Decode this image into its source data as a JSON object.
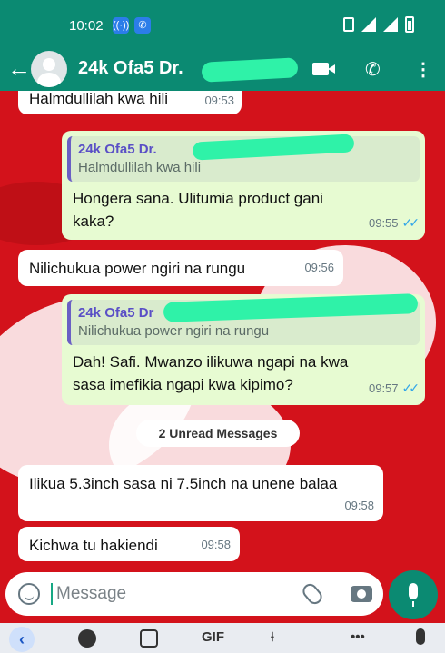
{
  "status_bar": {
    "time": "10:02"
  },
  "header": {
    "title": "24k Ofa5 Dr."
  },
  "messages": [
    {
      "dir": "in",
      "text": "Halmdullilah kwa hili",
      "time": "09:53"
    },
    {
      "dir": "out",
      "quote": {
        "name": "24k Ofa5 Dr.",
        "text": "Halmdullilah kwa hili"
      },
      "text": "Hongera sana. Ulitumia product gani kaka?",
      "time": "09:55",
      "status": "read"
    },
    {
      "dir": "in",
      "text": "Nilichukua power ngiri na rungu",
      "time": "09:56"
    },
    {
      "dir": "out",
      "quote": {
        "name": "24k Ofa5 Dr",
        "text": "Nilichukua power ngiri na rungu"
      },
      "text": "Dah! Safi. Mwanzo ilikuwa ngapi na kwa sasa imefikia ngapi kwa kipimo?",
      "time": "09:57",
      "status": "read"
    },
    {
      "dir": "in",
      "text": "Ilikua 5.3inch sasa ni 7.5inch na unene balaa",
      "time": "09:58"
    },
    {
      "dir": "in",
      "text": "Kichwa tu hakiendi",
      "time": "09:58"
    }
  ],
  "unread_label": "2 Unread Messages",
  "input": {
    "placeholder": "Message"
  },
  "keyboard": {
    "gif_label": "GIF",
    "more_label": "•••"
  },
  "colors": {
    "header": "#0b8a72",
    "outgoing": "#e7fbd2",
    "incoming": "#ffffff",
    "wallpaper": "#d3121b"
  }
}
